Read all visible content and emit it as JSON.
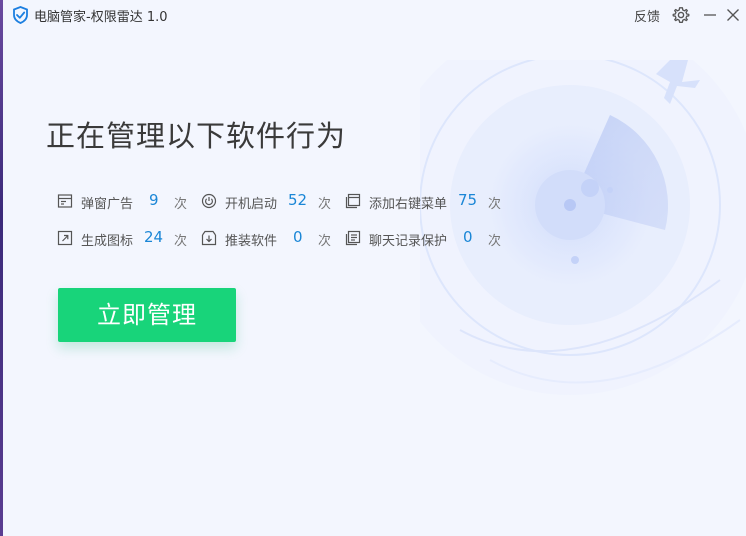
{
  "window": {
    "title": "电脑管家-权限雷达 1.0",
    "feedback_label": "反馈",
    "settings_icon": "gear-icon",
    "minimize_icon": "minimize-icon",
    "close_icon": "close-icon"
  },
  "main": {
    "headline": "正在管理以下软件行为",
    "stats": [
      {
        "label": "弹窗广告",
        "value": "9",
        "unit": "次",
        "icon": "popup-window-icon"
      },
      {
        "label": "开机启动",
        "value": "52",
        "unit": "次",
        "icon": "power-icon"
      },
      {
        "label": "添加右键菜单",
        "value": "75",
        "unit": "次",
        "icon": "context-menu-icon"
      },
      {
        "label": "生成图标",
        "value": "24",
        "unit": "次",
        "icon": "shortcut-icon"
      },
      {
        "label": "推装软件",
        "value": "0",
        "unit": "次",
        "icon": "download-install-icon"
      },
      {
        "label": "聊天记录保护",
        "value": "0",
        "unit": "次",
        "icon": "chat-record-icon"
      }
    ],
    "manage_button_label": "立即管理"
  },
  "colors": {
    "accent_green": "#18d47a",
    "value_blue": "#1a86d6",
    "background": "#f3f6fe"
  }
}
